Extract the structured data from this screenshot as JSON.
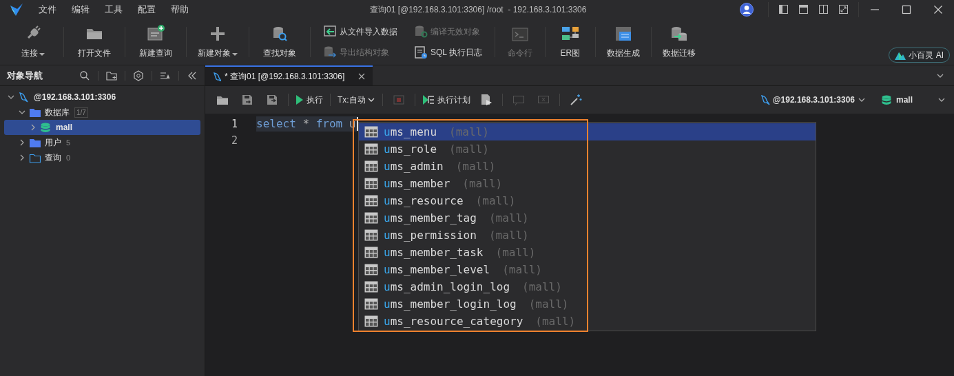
{
  "window": {
    "title": "查询01 [@192.168.3.101:3306] /root  - 192.168.3.101:3306"
  },
  "menu": [
    "文件",
    "编辑",
    "工具",
    "配置",
    "帮助"
  ],
  "toolbar": [
    {
      "kind": "large",
      "label": "连接",
      "dropdown": true,
      "disabled": false
    },
    {
      "kind": "large",
      "label": "打开文件",
      "dropdown": false,
      "disabled": false
    },
    {
      "kind": "large",
      "label": "新建查询",
      "dropdown": false,
      "disabled": false
    },
    {
      "kind": "large",
      "label": "新建对象",
      "dropdown": true,
      "disabled": false
    },
    {
      "kind": "large",
      "label": "查找对象",
      "dropdown": false,
      "disabled": false
    },
    {
      "kind": "small",
      "label": "从文件导入数据",
      "disabled": false
    },
    {
      "kind": "small",
      "label": "导出结构对象",
      "disabled": true
    },
    {
      "kind": "small",
      "label": "编译无效对象",
      "disabled": true
    },
    {
      "kind": "small",
      "label": "SQL 执行日志",
      "disabled": false
    },
    {
      "kind": "large",
      "label": "命令行",
      "dropdown": false,
      "disabled": true
    },
    {
      "kind": "large",
      "label": "ER图",
      "dropdown": false,
      "disabled": false
    },
    {
      "kind": "large",
      "label": "数据生成",
      "dropdown": false,
      "disabled": false
    },
    {
      "kind": "large",
      "label": "数据迁移",
      "dropdown": false,
      "disabled": false
    }
  ],
  "ai_button": {
    "label": "小百灵 AI"
  },
  "sidebar": {
    "title": "对象导航",
    "tree": [
      {
        "kind": "connection",
        "label": "@192.168.3.101:3306",
        "expanded": true,
        "selected": false,
        "children": [
          {
            "kind": "folder",
            "label": "数据库",
            "badge": "1/7",
            "expanded": true,
            "selected": false,
            "children": [
              {
                "kind": "database",
                "label": "mall",
                "expanded": false,
                "selected": true
              }
            ]
          },
          {
            "kind": "folder",
            "label": "用户",
            "count": "5",
            "expanded": false,
            "selected": false
          },
          {
            "kind": "query-folder",
            "label": "查询",
            "count": "0",
            "expanded": false,
            "selected": false
          }
        ]
      }
    ]
  },
  "tabs": [
    {
      "label": "* 查询01 [@192.168.3.101:3306]",
      "selected": true
    }
  ],
  "editor_toolbar": {
    "run": "执行",
    "transaction": "Tx:自动",
    "plan": "执行计划",
    "connection": "@192.168.3.101:3306",
    "database": "mall"
  },
  "editor": {
    "lines": [
      {
        "number": "1",
        "current": true,
        "tokens": [
          {
            "kind": "keyword",
            "text": "select"
          },
          {
            "kind": "plain",
            "text": " * "
          },
          {
            "kind": "keyword",
            "text": "from"
          },
          {
            "kind": "plain",
            "text": " u"
          }
        ]
      },
      {
        "number": "2",
        "current": false
      }
    ]
  },
  "autocomplete": {
    "items": [
      {
        "match": "u",
        "rest": "ms_menu",
        "schema": "(mall)",
        "selected": true
      },
      {
        "match": "u",
        "rest": "ms_role",
        "schema": "(mall)",
        "selected": false
      },
      {
        "match": "u",
        "rest": "ms_admin",
        "schema": "(mall)",
        "selected": false
      },
      {
        "match": "u",
        "rest": "ms_member",
        "schema": "(mall)",
        "selected": false
      },
      {
        "match": "u",
        "rest": "ms_resource",
        "schema": "(mall)",
        "selected": false
      },
      {
        "match": "u",
        "rest": "ms_member_tag",
        "schema": "(mall)",
        "selected": false
      },
      {
        "match": "u",
        "rest": "ms_permission",
        "schema": "(mall)",
        "selected": false
      },
      {
        "match": "u",
        "rest": "ms_member_task",
        "schema": "(mall)",
        "selected": false
      },
      {
        "match": "u",
        "rest": "ms_member_level",
        "schema": "(mall)",
        "selected": false
      },
      {
        "match": "u",
        "rest": "ms_admin_login_log",
        "schema": "(mall)",
        "selected": false
      },
      {
        "match": "u",
        "rest": "ms_member_login_log",
        "schema": "(mall)",
        "selected": false
      },
      {
        "match": "u",
        "rest": "ms_resource_category",
        "schema": "(mall)",
        "selected": false
      }
    ]
  }
}
